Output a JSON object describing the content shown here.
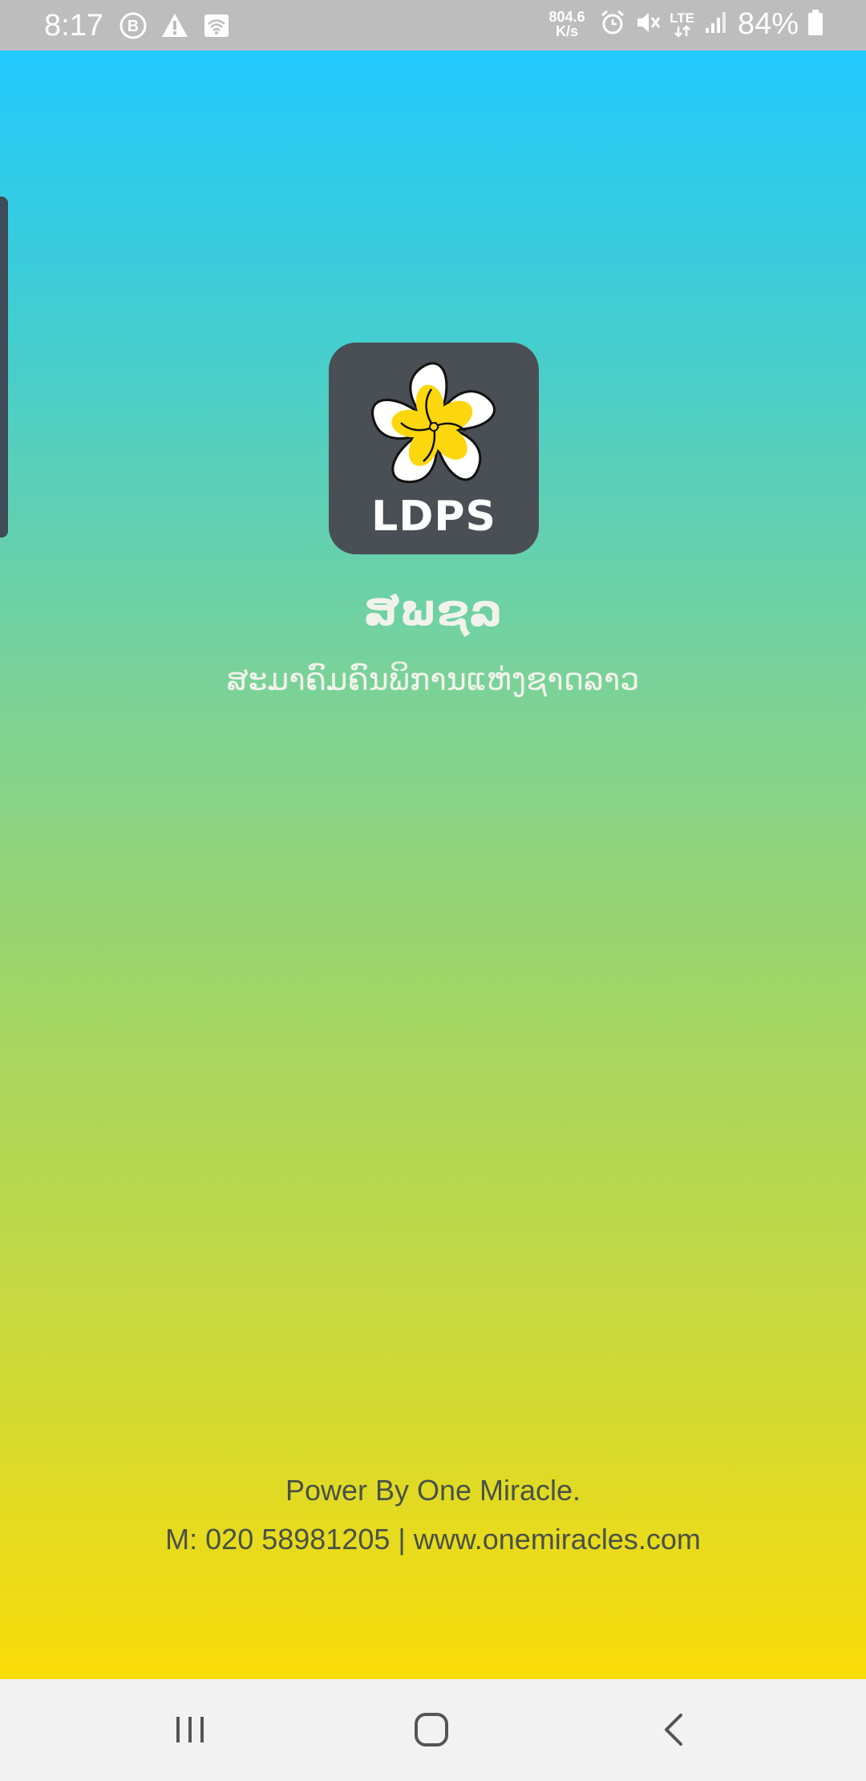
{
  "status_bar": {
    "time": "8:17",
    "net_speed_value": "804.6",
    "net_speed_unit": "K/s",
    "network_type": "LTE",
    "battery": "84%",
    "icons": [
      "b-badge-icon",
      "warning-icon",
      "wifi-calling-icon",
      "alarm-icon",
      "mute-icon",
      "lte-icon",
      "signal-icon",
      "battery-icon"
    ]
  },
  "splash": {
    "logo_text": "LDPS",
    "org_abbreviation": "ສພຊລ",
    "org_full_name": "ສະມາຄົມຄົນພິການແຫ່ງຊາດລາວ",
    "credit": "Power By One Miracle.",
    "contact": "M: 020 58981205 | www.onemiracles.com"
  },
  "colors": {
    "gradient_top": "#21c9fd",
    "gradient_bottom": "#fbdc08",
    "logo_background": "#4a4f55",
    "flower_yellow": "#fdd70e"
  },
  "nav_bar": {
    "buttons": [
      "recents-icon",
      "home-icon",
      "back-icon"
    ]
  }
}
